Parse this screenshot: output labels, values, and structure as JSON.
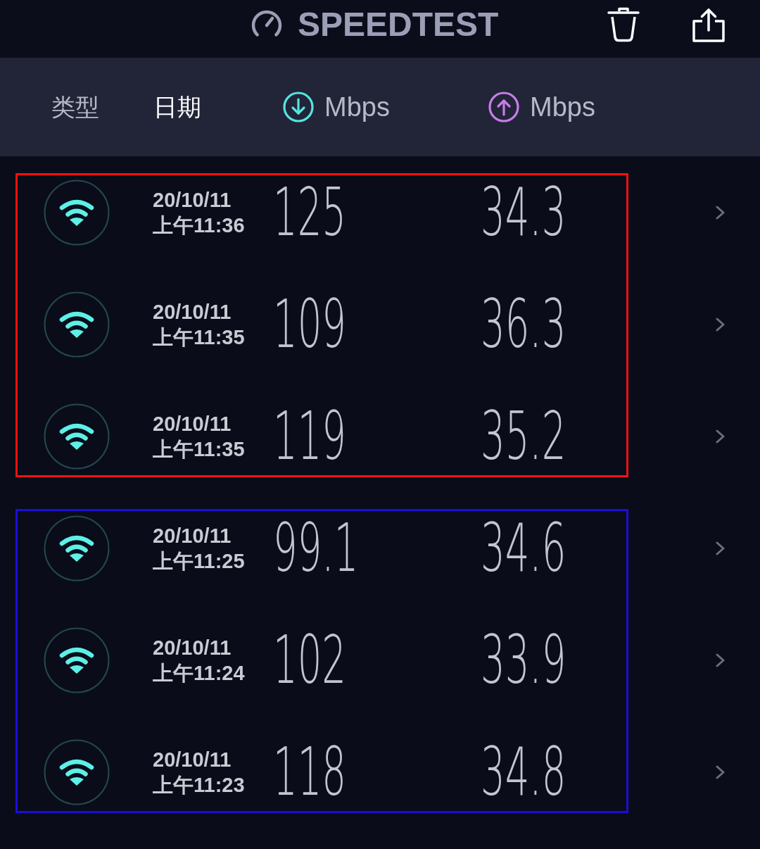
{
  "header": {
    "title": "SPEEDTEST"
  },
  "columns": [
    {
      "label": "类型",
      "kind": "text",
      "selected": false
    },
    {
      "label": "日期",
      "kind": "text",
      "selected": true
    },
    {
      "label": "Mbps",
      "kind": "download",
      "selected": false
    },
    {
      "label": "Mbps",
      "kind": "upload",
      "selected": false
    }
  ],
  "groups": [
    {
      "color": "#ee1111",
      "results": [
        {
          "date": "20/10/11",
          "time": "上午11:36",
          "download": "125",
          "upload": "34.3"
        },
        {
          "date": "20/10/11",
          "time": "上午11:35",
          "download": "109",
          "upload": "36.3"
        },
        {
          "date": "20/10/11",
          "time": "上午11:35",
          "download": "119",
          "upload": "35.2"
        }
      ]
    },
    {
      "color": "#1a0fd6",
      "results": [
        {
          "date": "20/10/11",
          "time": "上午11:25",
          "download": "99.1",
          "upload": "34.6"
        },
        {
          "date": "20/10/11",
          "time": "上午11:24",
          "download": "102",
          "upload": "33.9"
        },
        {
          "date": "20/10/11",
          "time": "上午11:23",
          "download": "118",
          "upload": "34.8"
        }
      ]
    }
  ]
}
